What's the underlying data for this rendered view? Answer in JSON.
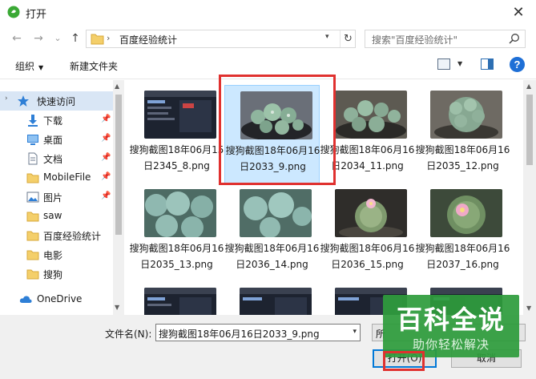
{
  "dialog": {
    "title": "打开",
    "close_glyph": "✕"
  },
  "address": {
    "folder": "百度经验统计",
    "chevron": "›",
    "refresh_glyph": "↻",
    "search_placeholder": "搜索\"百度经验统计\""
  },
  "nav": {
    "back": "←",
    "forward": "→",
    "recent": "⌄",
    "up": "↑"
  },
  "toolbar": {
    "organize_label": "组织",
    "new_folder_label": "新建文件夹",
    "help_glyph": "?"
  },
  "sidebar": {
    "items": [
      {
        "label": "快速访问",
        "icon": "star-icon",
        "pinned": false
      },
      {
        "label": "下载",
        "icon": "download-icon",
        "pinned": true
      },
      {
        "label": "桌面",
        "icon": "desktop-icon",
        "pinned": true
      },
      {
        "label": "文档",
        "icon": "document-icon",
        "pinned": true
      },
      {
        "label": "MobileFile",
        "icon": "folder-icon",
        "pinned": true
      },
      {
        "label": "图片",
        "icon": "pictures-icon",
        "pinned": true
      },
      {
        "label": "saw",
        "icon": "folder-icon",
        "pinned": false
      },
      {
        "label": "百度经验统计",
        "icon": "folder-icon",
        "pinned": false
      },
      {
        "label": "电影",
        "icon": "folder-icon",
        "pinned": false
      },
      {
        "label": "搜狗",
        "icon": "folder-icon",
        "pinned": false
      },
      {
        "label": "OneDrive",
        "icon": "cloud-icon",
        "pinned": false
      }
    ],
    "pin_glyph": "📌"
  },
  "files": [
    {
      "name": "搜狗截图18年06月15日2345_8.png",
      "kind": "screen"
    },
    {
      "name": "搜狗截图18年06月16日2033_9.png",
      "kind": "cactus",
      "selected": true
    },
    {
      "name": "搜狗截图18年06月16日2034_11.png",
      "kind": "cactus"
    },
    {
      "name": "搜狗截图18年06月16日2035_12.png",
      "kind": "cactus"
    },
    {
      "name": "搜狗截图18年06月16日2035_13.png",
      "kind": "cactus"
    },
    {
      "name": "搜狗截图18年06月16日2036_14.png",
      "kind": "cactus"
    },
    {
      "name": "搜狗截图18年06月16日2036_15.png",
      "kind": "flower"
    },
    {
      "name": "搜狗截图18年06月16日2037_16.png",
      "kind": "flower"
    },
    {
      "name": "",
      "kind": "screen"
    },
    {
      "name": "",
      "kind": "screen"
    },
    {
      "name": "",
      "kind": "screen"
    },
    {
      "name": "",
      "kind": "screen"
    }
  ],
  "bottom": {
    "filename_label": "文件名(N):",
    "filename_value": "搜狗截图18年06月16日2033_9.png",
    "filter_value": "所",
    "open_label": "打开(O)",
    "cancel_label": "取消"
  },
  "watermark": {
    "main": "百科全说",
    "sub": "助你轻松解决"
  },
  "colors": {
    "accent": "#0078d7",
    "selection": "#cce8ff",
    "highlight_red": "#e0312f",
    "watermark_green": "#2e9c3c"
  }
}
